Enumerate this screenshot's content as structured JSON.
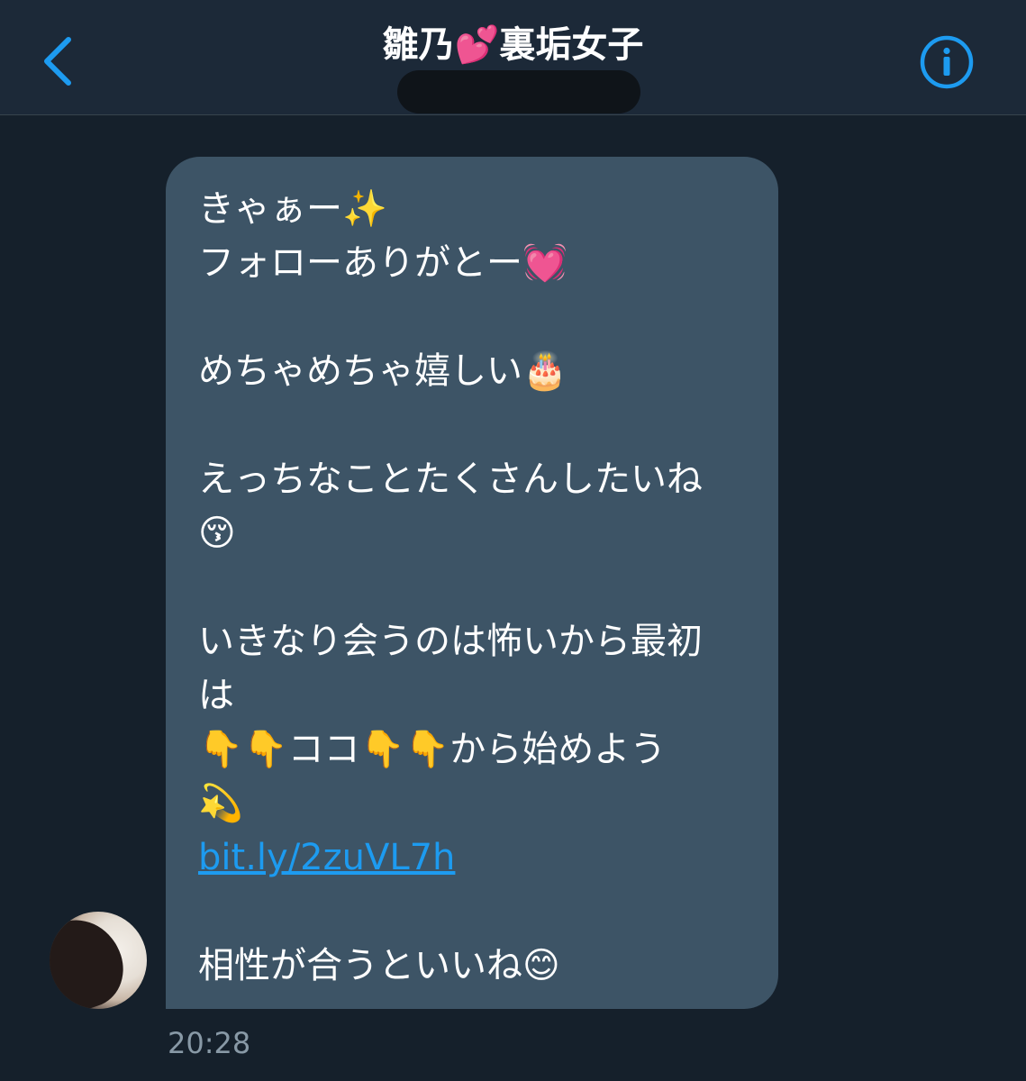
{
  "header": {
    "title": "雛乃💕裏垢女子",
    "back_icon": "chevron-left-icon",
    "info_icon": "info-circle-icon",
    "accent": "#1d9bf0"
  },
  "message": {
    "lines": [
      "きゃぁー✨",
      "フォローありがとー💓",
      "",
      "めちゃめちゃ嬉しい🎂",
      "",
      "えっちなことたくさんしたいね",
      "😚",
      "",
      "いきなり会うのは怖いから最初",
      "は",
      "👇👇ココ👇👇から始めよう",
      "💫"
    ],
    "link": "bit.ly/2zuVL7h",
    "closing": "相性が合うといいね😊",
    "timestamp": "20:28"
  },
  "colors": {
    "background": "#15202b",
    "header_bg": "#1c2938",
    "bubble_bg": "#3d5466",
    "timestamp": "#8899a6"
  }
}
